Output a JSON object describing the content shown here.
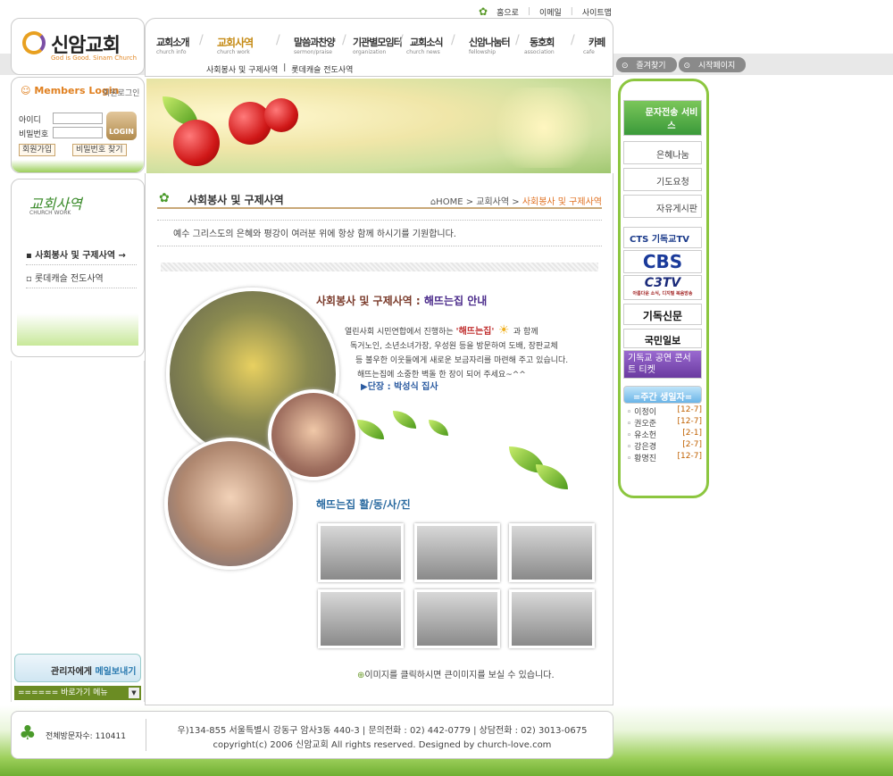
{
  "top_links": [
    "홈으로",
    "이메일",
    "사이트맵"
  ],
  "logo": {
    "name": "신암교회",
    "slogan": "God is Good. Sinam Church"
  },
  "login": {
    "title": "Members Login",
    "member_login": "회원로그인",
    "id_label": "아이디",
    "pw_label": "비밀번호",
    "login_btn": "LOGIN",
    "join": "회원가입",
    "find_pw": "비밀번호 찾기"
  },
  "gnb": {
    "items": [
      {
        "label": "교회소개",
        "sub": "church info"
      },
      {
        "label": "교회사역",
        "sub": "church work"
      },
      {
        "label": "말씀과찬양",
        "sub": "sermon/praise"
      },
      {
        "label": "기관별모임터",
        "sub": "organization"
      },
      {
        "label": "교회소식",
        "sub": "church news"
      },
      {
        "label": "신암나눔터",
        "sub": "fellowship"
      },
      {
        "label": "동호회",
        "sub": "association"
      },
      {
        "label": "카페",
        "sub": "cafe"
      }
    ],
    "submenu": [
      "사회봉사 및 구제사역",
      "롯데캐슬 전도사역"
    ]
  },
  "left_menu": {
    "title": "교회사역",
    "subtitle": "CHURCH WORK",
    "items": [
      "사회봉사 및 구제사역",
      "롯데캐슬 전도사역"
    ]
  },
  "mail_btn": {
    "pre": "관리자에게 ",
    "em": "메일보내기"
  },
  "quick_menu": "====== 바로가기 메뉴 ======",
  "page": {
    "title": "사회봉사 및 구제사역",
    "breadcrumb_home": "HOME",
    "breadcrumb_mid": "교회사역",
    "breadcrumb_cur": "사회봉사 및 구제사역",
    "greeting": "예수 그리스도의 은혜와 평강이 여러분 위에 항상 함께 하시기를 기원합니다."
  },
  "content": {
    "section_title": "사회봉사 및 구제사역 : ",
    "section_title_hl": "해뜨는집 안내",
    "line1_pre": "열린사회 시민연합에서 진행하는 ",
    "line1_red": "'해뜨는집'",
    "line1_post": " 과 함께",
    "line2": "독거노인, 소년소녀가장, 우성원 등을 방문하여 도배, 장판교체",
    "line3": "등 불우한 이웃들에게 새로운 보금자리를 마련해 주고 있습니다.",
    "line4": "해뜨는집에 소중한 벽돌 한 장이 되어 주세요~^^",
    "leader": "단장 : 박성식 집사",
    "activity_title": "해뜨는집 활/동/사/진",
    "note": "이미지를 클릭하시면 큰이미지를 보실 수 있습니다."
  },
  "footer": {
    "visitors_label": "전체방문자수:",
    "visitors": "110411",
    "address": "우)134-855 서울특별시 강동구 암사3동 440-3  |  문의전화 : 02) 442-0779  |  상담전화 : 02) 3013-0675",
    "copyright": "copyright(c) 2006 신암교회 All rights reserved. Designed by church-love.com"
  },
  "quick": {
    "fav": "즐겨찾기",
    "home": "시작페이지"
  },
  "right": {
    "sms": "문자전송 서비스",
    "grace": "은혜나눔",
    "prayer": "기도요청",
    "board": "자유게시판",
    "cts": "CTS 기독교TV",
    "cbs": "CBS",
    "c3tv": "C3TV",
    "c3tv_sub": "아름다운 소식, 디지털 복음방송",
    "kidok": "기독신문",
    "kukmin": "국민일보",
    "concert": "기독교 공연 콘서트 티켓",
    "birthday_title": "=주간 생일자=",
    "birthdays": [
      {
        "name": "이정이",
        "date": "[12-7]"
      },
      {
        "name": "권오준",
        "date": "[12-7]"
      },
      {
        "name": "유소헌",
        "date": "[2-1]"
      },
      {
        "name": "강은경",
        "date": "[2-7]"
      },
      {
        "name": "황명진",
        "date": "[12-7]"
      }
    ]
  },
  "colors": {
    "accent": "#8cc63f",
    "brand": "#e08020",
    "breadcrumb": "#e07020"
  }
}
